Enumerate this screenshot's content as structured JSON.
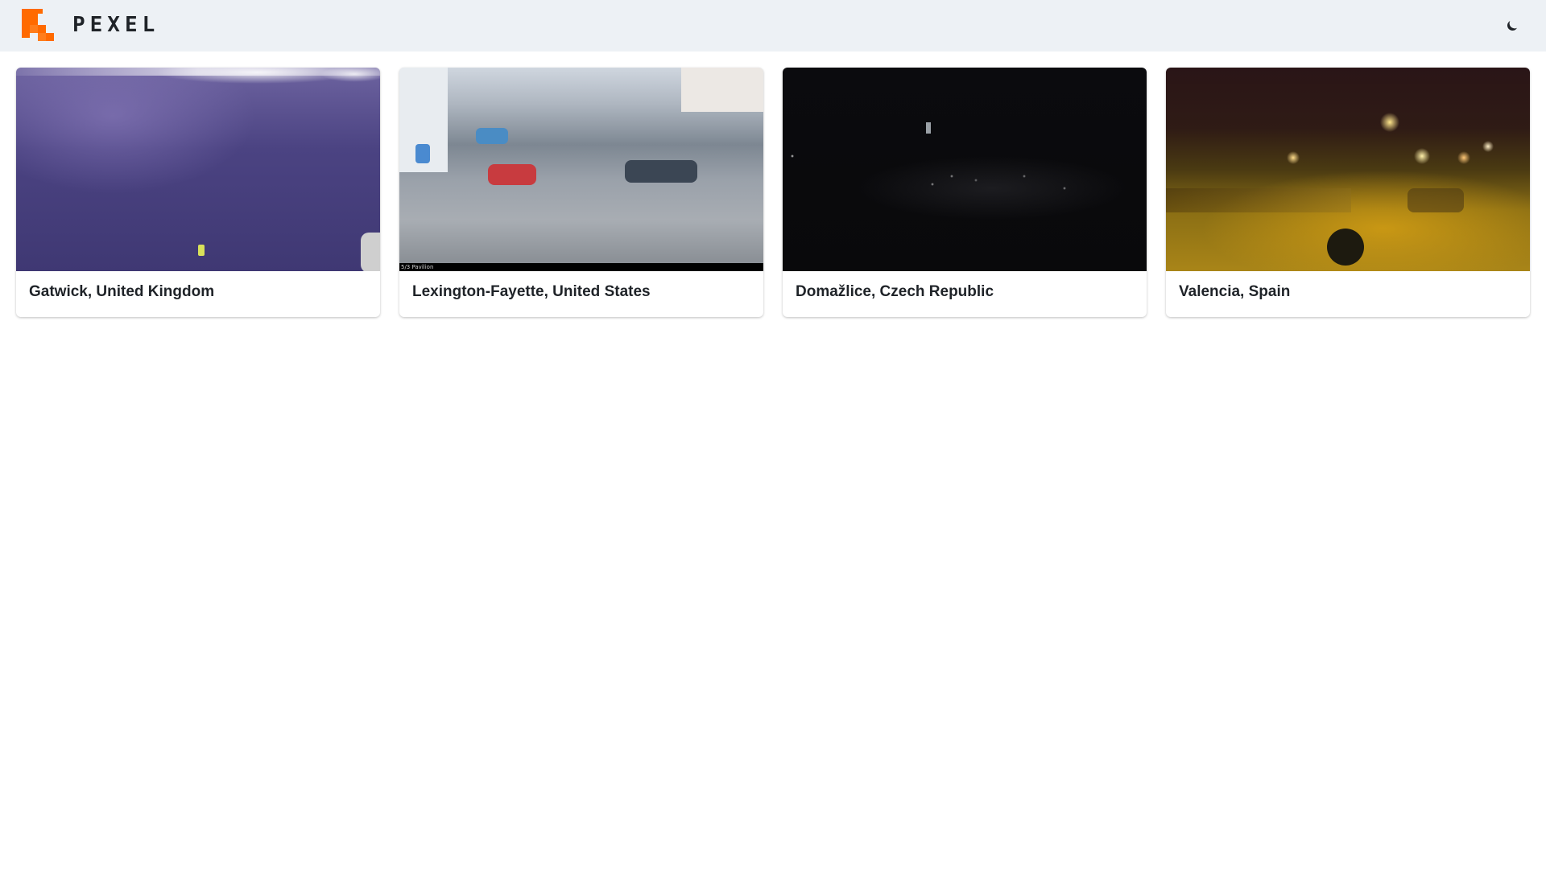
{
  "header": {
    "brand": "PEXEL",
    "logo_icon": "pixel-arrow-logo-icon",
    "theme_toggle_icon": "moon-icon",
    "accent_color": "#ff6a00"
  },
  "webcams": [
    {
      "label": "Gatwick, United Kingdom"
    },
    {
      "label": "Lexington-Fayette, United States",
      "caption": "5/3 Pavilion"
    },
    {
      "label": "Domažlice, Czech Republic"
    },
    {
      "label": "Valencia, Spain"
    }
  ]
}
